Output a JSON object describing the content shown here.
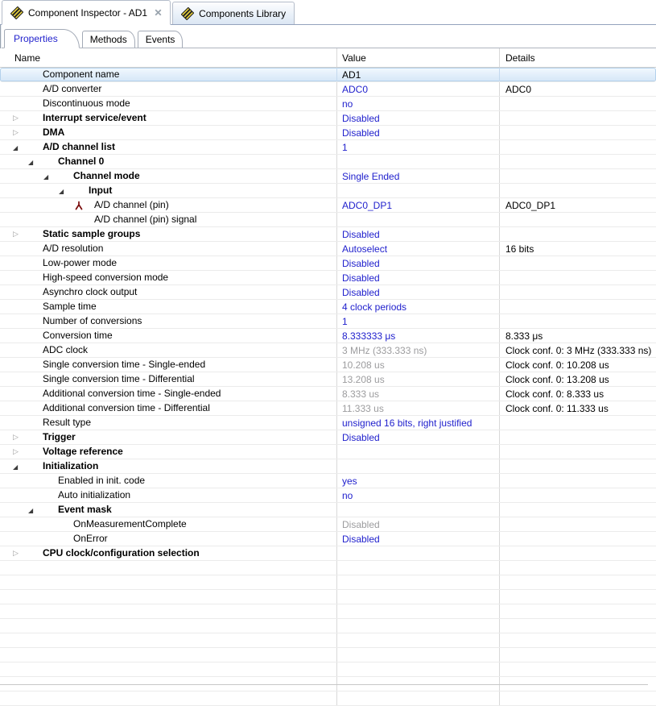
{
  "view_tabs": {
    "inspector": {
      "label": "Component Inspector - AD1",
      "icon": "component-icon",
      "closable": true
    },
    "library": {
      "label": "Components Library",
      "icon": "component-icon"
    }
  },
  "tabs": {
    "properties": {
      "label": "Properties",
      "active": true
    },
    "methods": {
      "label": "Methods"
    },
    "events": {
      "label": "Events"
    }
  },
  "table": {
    "columns": {
      "name": "Name",
      "value": "Value",
      "details": "Details"
    },
    "rows": [
      {
        "level": 0,
        "label": "Component name",
        "value": "AD1",
        "value_style": "black",
        "details": "",
        "selected": true
      },
      {
        "level": 0,
        "label": "A/D converter",
        "value": "ADC0",
        "value_style": "blue",
        "details": "ADC0"
      },
      {
        "level": 0,
        "label": "Discontinuous mode",
        "value": "no",
        "value_style": "blue",
        "details": ""
      },
      {
        "level": 0,
        "label": "Interrupt service/event",
        "bold": true,
        "arrow": "collapsed",
        "value": "Disabled",
        "value_style": "blue",
        "details": ""
      },
      {
        "level": 0,
        "label": "DMA",
        "bold": true,
        "arrow": "collapsed",
        "value": "Disabled",
        "value_style": "blue",
        "details": ""
      },
      {
        "level": 0,
        "label": "A/D channel list",
        "bold": true,
        "arrow": "expanded",
        "value": "1",
        "value_style": "blue",
        "details": ""
      },
      {
        "level": 1,
        "label": "Channel 0",
        "bold": true,
        "arrow": "expanded",
        "value": "",
        "details": ""
      },
      {
        "level": 2,
        "label": "Channel mode",
        "bold": true,
        "arrow": "expanded",
        "value": "Single Ended",
        "value_style": "blue",
        "details": ""
      },
      {
        "level": 3,
        "label": "Input",
        "bold": true,
        "arrow": "expanded",
        "value": "",
        "details": ""
      },
      {
        "level": 4,
        "label": "A/D channel (pin)",
        "icon": "pin",
        "value": "ADC0_DP1",
        "value_style": "blue",
        "details": "ADC0_DP1"
      },
      {
        "level": 4,
        "label": "A/D channel (pin) signal",
        "value": "",
        "details": ""
      },
      {
        "level": 0,
        "label": "Static sample groups",
        "bold": true,
        "arrow": "collapsed",
        "value": "Disabled",
        "value_style": "blue",
        "details": ""
      },
      {
        "level": 0,
        "label": "A/D resolution",
        "value": "Autoselect",
        "value_style": "blue",
        "details": "16 bits"
      },
      {
        "level": 0,
        "label": "Low-power mode",
        "value": "Disabled",
        "value_style": "blue",
        "details": ""
      },
      {
        "level": 0,
        "label": "High-speed conversion mode",
        "value": "Disabled",
        "value_style": "blue",
        "details": ""
      },
      {
        "level": 0,
        "label": "Asynchro clock output",
        "value": "Disabled",
        "value_style": "blue",
        "details": ""
      },
      {
        "level": 0,
        "label": "Sample time",
        "value": "4 clock periods",
        "value_style": "blue",
        "details": ""
      },
      {
        "level": 0,
        "label": "Number of conversions",
        "value": "1",
        "value_style": "blue",
        "details": ""
      },
      {
        "level": 0,
        "label": "Conversion time",
        "value": "8.333333 μs",
        "value_style": "blue",
        "details": "8.333 μs"
      },
      {
        "level": 0,
        "label": "ADC clock",
        "value": "3 MHz (333.333 ns)",
        "value_style": "gray",
        "details": "Clock conf. 0: 3 MHz (333.333 ns)"
      },
      {
        "level": 0,
        "label": "Single conversion time - Single-ended",
        "value": "10.208 us",
        "value_style": "gray",
        "details": "Clock conf. 0: 10.208 us"
      },
      {
        "level": 0,
        "label": "Single conversion time - Differential",
        "value": "13.208 us",
        "value_style": "gray",
        "details": "Clock conf. 0: 13.208 us"
      },
      {
        "level": 0,
        "label": "Additional conversion time - Single-ended",
        "value": "8.333 us",
        "value_style": "gray",
        "details": "Clock conf. 0: 8.333 us"
      },
      {
        "level": 0,
        "label": "Additional conversion time - Differential",
        "value": "11.333 us",
        "value_style": "gray",
        "details": "Clock conf. 0: 11.333 us"
      },
      {
        "level": 0,
        "label": "Result type",
        "value": "unsigned 16 bits, right justified",
        "value_style": "blue",
        "details": ""
      },
      {
        "level": 0,
        "label": "Trigger",
        "bold": true,
        "arrow": "collapsed",
        "value": "Disabled",
        "value_style": "blue",
        "details": ""
      },
      {
        "level": 0,
        "label": "Voltage reference",
        "bold": true,
        "arrow": "collapsed",
        "value": "",
        "details": ""
      },
      {
        "level": 0,
        "label": "Initialization",
        "bold": true,
        "arrow": "expanded",
        "value": "",
        "details": ""
      },
      {
        "level": 1,
        "label": "Enabled in init. code",
        "value": "yes",
        "value_style": "blue",
        "details": ""
      },
      {
        "level": 1,
        "label": "Auto initialization",
        "value": "no",
        "value_style": "blue",
        "details": ""
      },
      {
        "level": 1,
        "label": "Event mask",
        "bold": true,
        "arrow": "expanded",
        "value": "",
        "details": ""
      },
      {
        "level": 2,
        "label": "OnMeasurementComplete",
        "value": "Disabled",
        "value_style": "gray",
        "details": ""
      },
      {
        "level": 2,
        "label": "OnError",
        "value": "Disabled",
        "value_style": "blue",
        "details": ""
      },
      {
        "level": 0,
        "label": "CPU clock/configuration selection",
        "bold": true,
        "arrow": "collapsed",
        "value": "",
        "details": ""
      }
    ]
  },
  "colors": {
    "value_blue": "#2121cd",
    "value_gray": "#9c9c9e",
    "selection_fill": "#e3effb",
    "selection_border": "#b3d1ec",
    "active_tab_text": "#2323cd",
    "pin_icon": "#7a0c0c"
  }
}
